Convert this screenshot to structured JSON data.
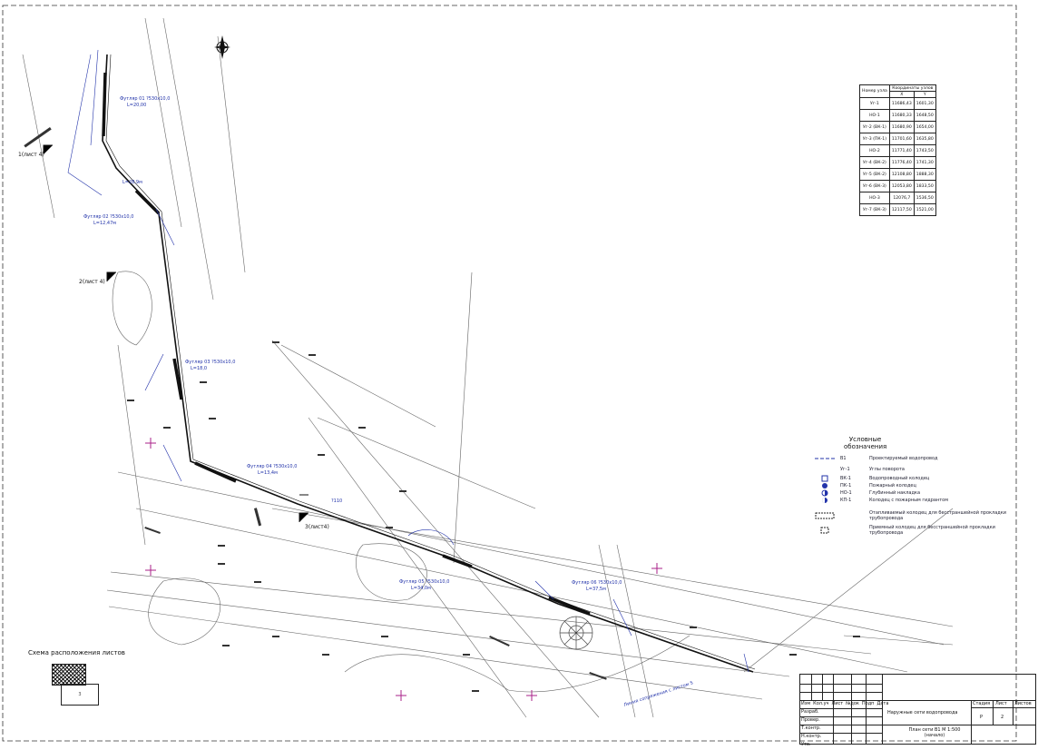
{
  "coord_table": {
    "header_left": "Номер узла",
    "header_group": "Координаты узлов",
    "header_x": "X",
    "header_y": "Y",
    "rows": [
      {
        "name": "Уг-1",
        "x": "11686,43",
        "y": "1601,30"
      },
      {
        "name": "НО-1",
        "x": "11680,33",
        "y": "1648,50"
      },
      {
        "name": "Уг-2 (ВК-1)",
        "x": "11680,90",
        "y": "1654,00"
      },
      {
        "name": "Уг-3 (ПК-1)",
        "x": "11701,60",
        "y": "1635,80"
      },
      {
        "name": "НО-2",
        "x": "11771,40",
        "y": "1743,50"
      },
      {
        "name": "Уг-4 (ВК-2)",
        "x": "11776,40",
        "y": "1741,30"
      },
      {
        "name": "Уг-5 (ВК-2)",
        "x": "12108,80",
        "y": "1888,30"
      },
      {
        "name": "Уг-6 (ВК-3)",
        "x": "12053,80",
        "y": "1833,50"
      },
      {
        "name": "НО-3",
        "x": "12076,7",
        "y": "1536,50"
      },
      {
        "name": "Уг-7 (ВК-3)",
        "x": "12117,50",
        "y": "1521,00"
      }
    ]
  },
  "legend": {
    "title_line1": "Условные",
    "title_line2": "обозначения",
    "items": [
      {
        "key": "В1",
        "text": "Проектируемый водопровод"
      },
      {
        "key": "Уг-1",
        "text": "Углы поворота"
      },
      {
        "key": "ВК-1",
        "text": "Водопроводный колодец"
      },
      {
        "key": "ПК-1",
        "text": "Пожарный колодец"
      },
      {
        "key": "НО-1",
        "text": "Глубинный накладка"
      },
      {
        "key": "КП-1",
        "text": "Колодец с пожарным гидрантом"
      },
      {
        "key": "",
        "text": "Отапливаемый колодец для бесстраншейной прокладки трубопровода"
      },
      {
        "key": "",
        "text": "Приемный колодец для бесстраншейной прокладки трубопровода"
      }
    ]
  },
  "annotations": {
    "sheet1": "1(лист 4)",
    "sheet2": "2(лист 4)",
    "sheet3": "3(лист4)",
    "case1": "Футляр 01 ?530х10,0",
    "case1_len": "L=20,00",
    "case2": "Футляр 02 ?530х10,0",
    "case2_len": "L=12,47м",
    "case3": "Футляр 03 ?530х10,0",
    "case3_len": "L=18,0",
    "case4": "Футляр 04 ?530х10,0",
    "case4_len": "L=13,4м",
    "case5": "Футляр 05 ?530х10,0",
    "case5_len": "L=34,0м",
    "case6": "Футляр 06 ?530х10,0",
    "case6_len": "L=37,5м",
    "pipe": "?110",
    "dim1": "L=28,9м",
    "boundary": "Линия сопряжения с листом 5",
    "scheme_label": "Схема расположения листов",
    "sheet_box": "3"
  },
  "stamp": {
    "row_labels": [
      "Изм",
      "Кол.уч",
      "Лист",
      "№док",
      "Подп",
      "Дата"
    ],
    "roles": [
      "Разраб.",
      "Провер.",
      "Т.контр.",
      "Н.контр.",
      "Утв."
    ],
    "project_title": "Наружные сети водопровода",
    "sheet_title": "План сети В1 М 1:500 (начало)",
    "col_stage": "Стадия",
    "col_sheet": "Лист",
    "col_sheets": "Листов",
    "stage": "Р",
    "sheet": "2"
  },
  "colors": {
    "pipe": "#111111",
    "annotation": "#2233aa",
    "magenta": "#aa2288",
    "lines": "#666666"
  }
}
